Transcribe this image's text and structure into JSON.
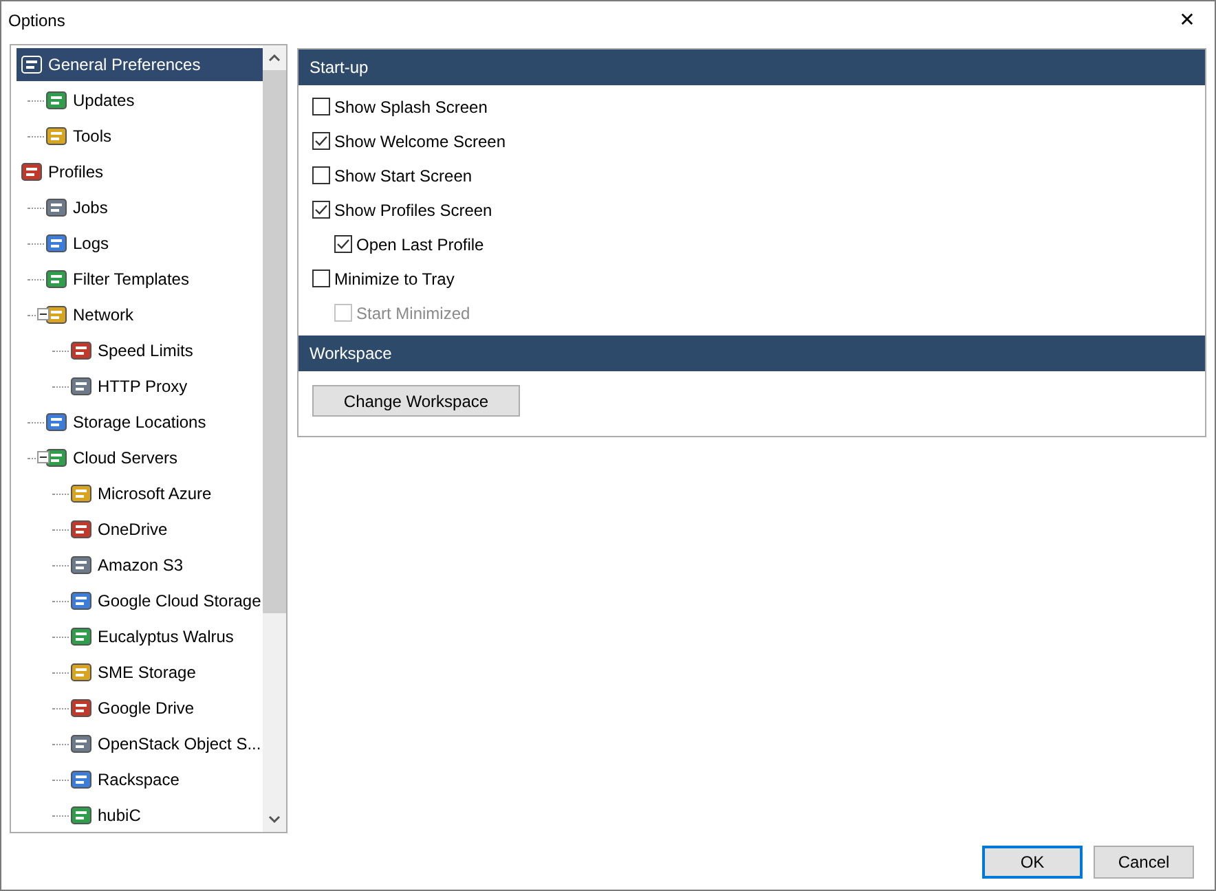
{
  "window": {
    "title": "Options",
    "close": "✕"
  },
  "tree": {
    "items": [
      {
        "label": "General Preferences",
        "selected": true,
        "children": [
          {
            "label": "Updates",
            "selected": false
          },
          {
            "label": "Tools",
            "selected": false
          }
        ]
      },
      {
        "label": "Profiles",
        "selected": false,
        "children": [
          {
            "label": "Jobs",
            "selected": false
          },
          {
            "label": "Logs",
            "selected": false
          },
          {
            "label": "Filter Templates",
            "selected": false
          },
          {
            "label": "Network",
            "selected": false,
            "expanded": true,
            "children": [
              {
                "label": "Speed Limits",
                "selected": false
              },
              {
                "label": "HTTP Proxy",
                "selected": false
              }
            ]
          },
          {
            "label": "Storage Locations",
            "selected": false
          },
          {
            "label": "Cloud Servers",
            "selected": false,
            "expanded": true,
            "children": [
              {
                "label": "Microsoft Azure",
                "selected": false
              },
              {
                "label": "OneDrive",
                "selected": false
              },
              {
                "label": "Amazon S3",
                "selected": false
              },
              {
                "label": "Google Cloud Storage",
                "selected": false
              },
              {
                "label": "Eucalyptus Walrus",
                "selected": false
              },
              {
                "label": "SME Storage",
                "selected": false
              },
              {
                "label": "Google Drive",
                "selected": false
              },
              {
                "label": "OpenStack Object S...",
                "selected": false
              },
              {
                "label": "Rackspace",
                "selected": false
              },
              {
                "label": "hubiC",
                "selected": false
              }
            ]
          }
        ]
      }
    ]
  },
  "sections": [
    {
      "title": "Start-up",
      "options": [
        {
          "label": "Show Splash Screen",
          "checked": false,
          "disabled": false
        },
        {
          "label": "Show Welcome Screen",
          "checked": true,
          "disabled": false
        },
        {
          "label": "Show Start Screen",
          "checked": false,
          "disabled": false
        },
        {
          "label": "Show Profiles Screen",
          "checked": true,
          "disabled": false,
          "children": [
            {
              "label": "Open Last Profile",
              "checked": true,
              "disabled": false
            }
          ]
        },
        {
          "label": "Minimize to Tray",
          "checked": false,
          "disabled": false,
          "children": [
            {
              "label": "Start Minimized",
              "checked": false,
              "disabled": true
            }
          ]
        }
      ]
    },
    {
      "title": "Workspace",
      "buttons": [
        "Change Workspace"
      ]
    }
  ],
  "buttons": [
    {
      "label": "OK",
      "default": true
    },
    {
      "label": "Cancel",
      "default": false
    }
  ]
}
